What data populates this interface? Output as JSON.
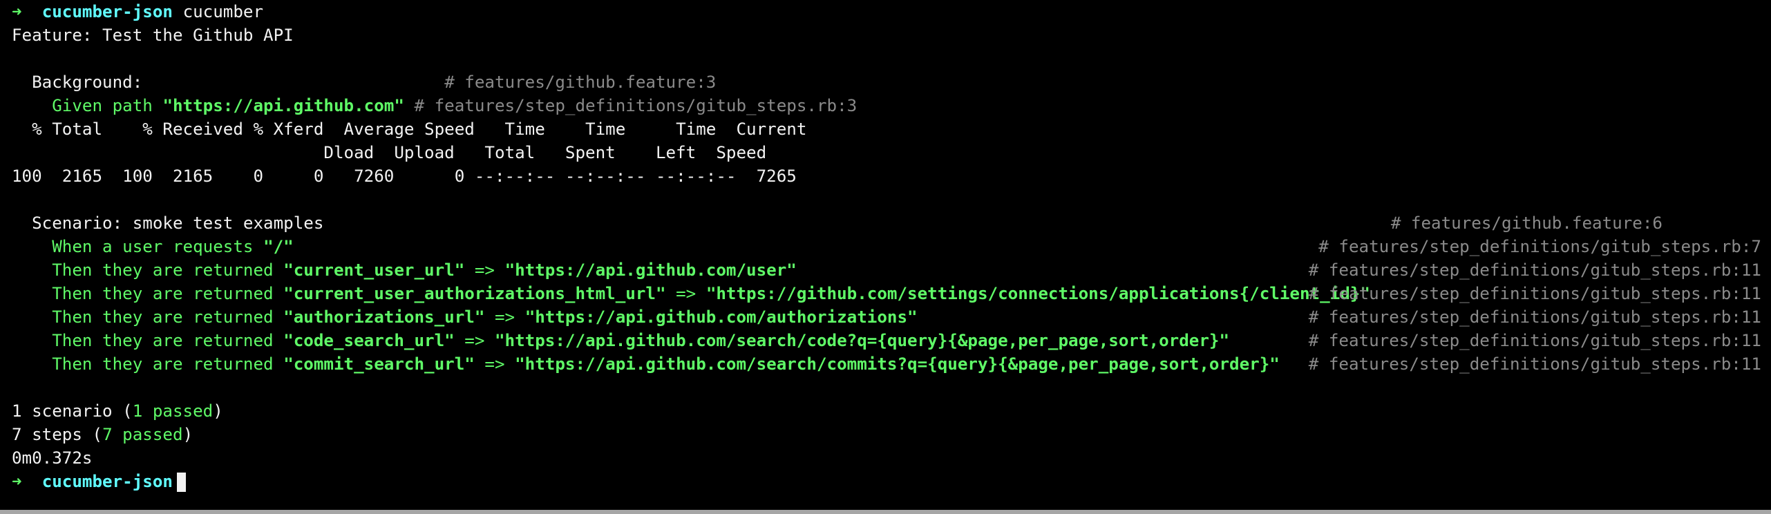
{
  "prompt": {
    "arrow": "➜",
    "dir": "cucumber-json",
    "command": "cucumber"
  },
  "feature_line": "Feature: Test the Github API",
  "background": {
    "label": "Background:",
    "comment": "# features/github.feature:3",
    "given_text": "Given path ",
    "given_arg": "\"https://api.github.com\"",
    "given_comment": "# features/step_definitions/gitub_steps.rb:3"
  },
  "curl": {
    "header1": "% Total    % Received % Xferd  Average Speed   Time    Time     Time  Current",
    "header2": "                               Dload  Upload   Total   Spent    Left  Speed",
    "values": "100  2165  100  2165    0     0   7260      0 --:--:-- --:--:-- --:--:--  7265"
  },
  "scenario": {
    "label": "Scenario: smoke test examples",
    "comment": "# features/github.feature:6",
    "steps": [
      {
        "prefix": "When a user requests ",
        "key": "\"/\"",
        "arrow": "",
        "value": "",
        "comment": "# features/step_definitions/gitub_steps.rb:7"
      },
      {
        "prefix": "Then they are returned ",
        "key": "\"current_user_url\"",
        "arrow": " => ",
        "value": "\"https://api.github.com/user\"",
        "comment": "# features/step_definitions/gitub_steps.rb:11"
      },
      {
        "prefix": "Then they are returned ",
        "key": "\"current_user_authorizations_html_url\"",
        "arrow": " => ",
        "value": "\"https://github.com/settings/connections/applications{/client_id}\"",
        "comment": "# features/step_definitions/gitub_steps.rb:11"
      },
      {
        "prefix": "Then they are returned ",
        "key": "\"authorizations_url\"",
        "arrow": " => ",
        "value": "\"https://api.github.com/authorizations\"",
        "comment": "# features/step_definitions/gitub_steps.rb:11"
      },
      {
        "prefix": "Then they are returned ",
        "key": "\"code_search_url\"",
        "arrow": " => ",
        "value": "\"https://api.github.com/search/code?q={query}{&page,per_page,sort,order}\"",
        "comment": "# features/step_definitions/gitub_steps.rb:11"
      },
      {
        "prefix": "Then they are returned ",
        "key": "\"commit_search_url\"",
        "arrow": " => ",
        "value": "\"https://api.github.com/search/commits?q={query}{&page,per_page,sort,order}\"",
        "comment": "# features/step_definitions/gitub_steps.rb:11"
      }
    ]
  },
  "summary": {
    "scenarios_prefix": "1 scenario (",
    "scenarios_passed": "1 passed",
    "scenarios_suffix": ")",
    "steps_prefix": "7 steps (",
    "steps_passed": "7 passed",
    "steps_suffix": ")",
    "duration": "0m0.372s"
  },
  "final_prompt": {
    "arrow": "➜",
    "dir": "cucumber-json"
  },
  "colors": {
    "background": "#000000",
    "text": "#f2f2f2",
    "green": "#5ff967",
    "cyan": "#60fdff",
    "comment": "#8a8a8a"
  }
}
